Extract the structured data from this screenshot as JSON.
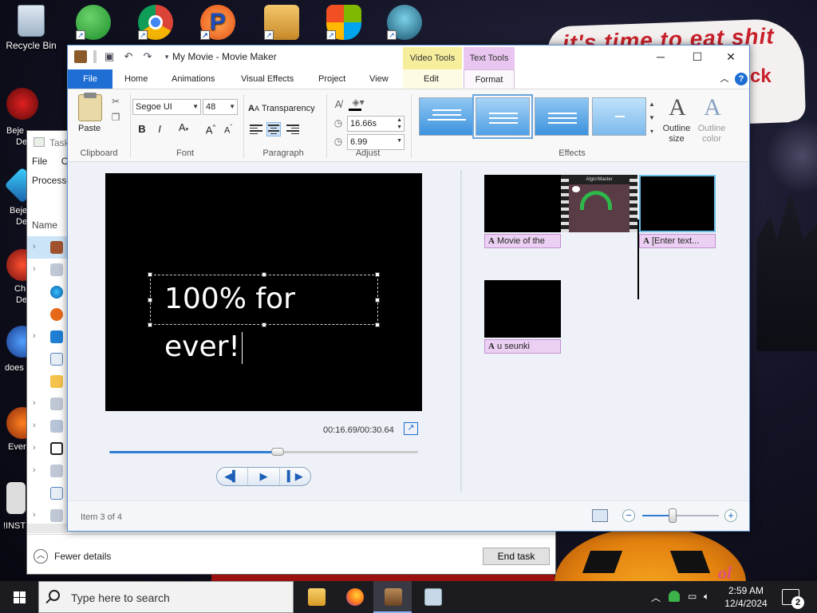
{
  "desktop": {
    "wallpaper_text_1": "it's time to eat shit",
    "wallpaper_text_2": "ck",
    "wallpaper_text_3": "ol",
    "icons": [
      {
        "label": "Recycle Bin",
        "icon": "recycle-bin-icon"
      },
      {
        "label": "",
        "icon": "people-icon"
      },
      {
        "label": "",
        "icon": "chrome-icon"
      },
      {
        "label": "",
        "icon": "p-app-icon"
      },
      {
        "label": "",
        "icon": "folder-zip-icon"
      },
      {
        "label": "",
        "icon": "windows-flag-icon"
      },
      {
        "label": "",
        "icon": "game-character-icon"
      }
    ],
    "left_labels": [
      "Beje",
      "De",
      "Beje",
      "De",
      "Ch",
      "De",
      "does",
      "Ever",
      "!INST"
    ]
  },
  "task_manager": {
    "title": "Task",
    "menu": [
      "File",
      "Op"
    ],
    "tab": "Processe",
    "column_name": "Name",
    "fewer_details": "Fewer details",
    "end_task": "End task"
  },
  "movie_maker": {
    "title": "My Movie - Movie Maker",
    "context_tabs": {
      "video_tools": "Video Tools",
      "text_tools": "Text Tools"
    },
    "tabs": [
      "File",
      "Home",
      "Animations",
      "Visual Effects",
      "Project",
      "View",
      "Edit",
      "Format"
    ],
    "active_tab": "Format",
    "ribbon": {
      "clipboard": {
        "paste": "Paste",
        "group": "Clipboard"
      },
      "font": {
        "family": "Segoe UI",
        "size": "48",
        "group": "Font"
      },
      "paragraph": {
        "transparency": "Transparency",
        "group": "Paragraph"
      },
      "adjust": {
        "start_time": "16.66s",
        "duration": "6.99",
        "group": "Adjust"
      },
      "effects": {
        "group": "Effects",
        "outline_size": "Outline size",
        "outline_color": "Outline color"
      }
    },
    "preview": {
      "overlay_text": "100% for ever!",
      "timecode": "00:16.69/00:30.64",
      "playback_progress": 0.545
    },
    "storyboard": {
      "captions": [
        "Movie of the",
        "[Enter text...",
        "u seunki"
      ],
      "clip_thumbnail_text": "AlgicrMaster"
    },
    "status": {
      "item": "Item 3 of 4",
      "zoom_level": 0.4
    }
  },
  "taskbar": {
    "search_placeholder": "Type here to search",
    "time": "2:59 AM",
    "date": "12/4/2024",
    "notification_count": "2"
  },
  "colors": {
    "accent": "#1e6ed4",
    "video_tools": "#f6ee9c",
    "text_tools": "#e8c6ef",
    "caption": "#ecd0f3"
  }
}
